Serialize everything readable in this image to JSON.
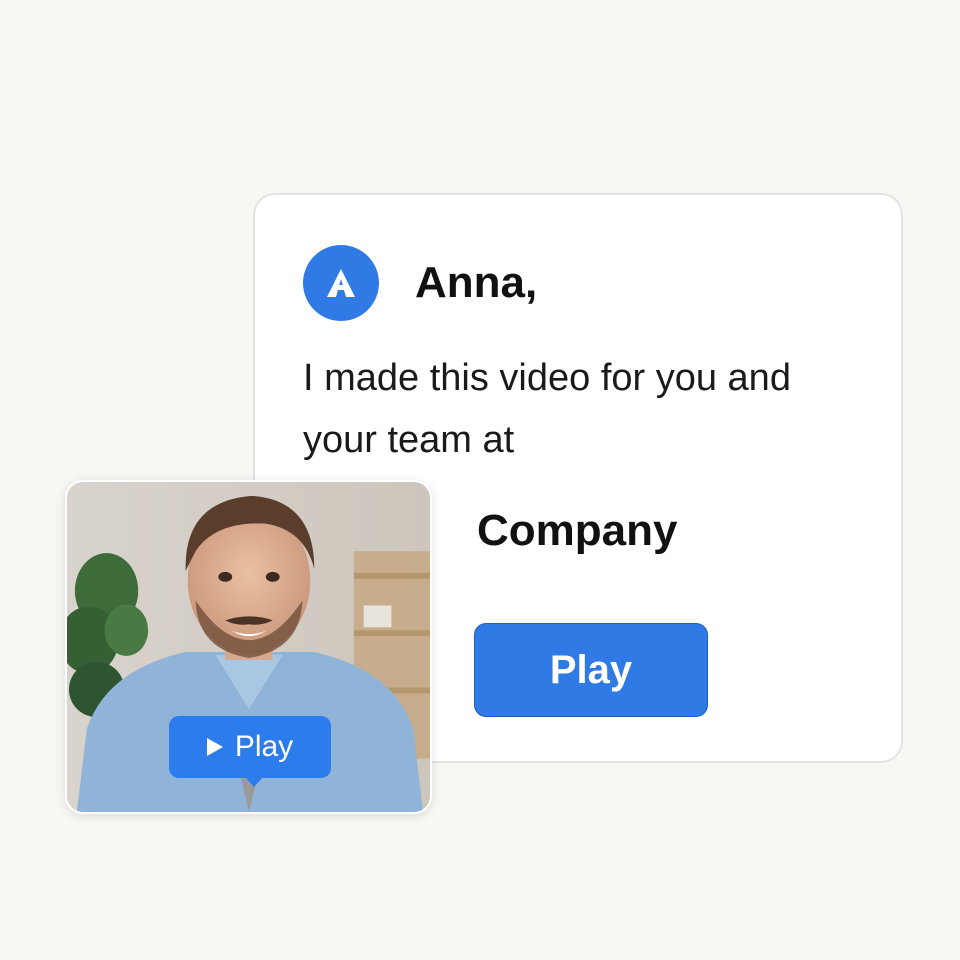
{
  "card": {
    "logo_icon": "brand-a-logo-icon",
    "greeting": "Anna,",
    "message": "I made this video for you and your team at",
    "company": "Company",
    "play_label": "Play"
  },
  "video": {
    "play_icon": "play-triangle-icon",
    "play_label": "Play"
  },
  "colors": {
    "accent": "#2f7ae5",
    "background": "#f8f7f4",
    "card": "#ffffff"
  }
}
